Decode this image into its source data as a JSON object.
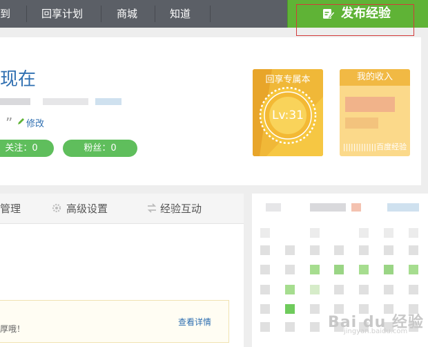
{
  "nav": {
    "items": [
      "到",
      "回享计划",
      "商城",
      "知道"
    ],
    "publish_label": "发布经验"
  },
  "profile": {
    "username_partial": "现在",
    "quote_mark": "”",
    "edit_label": "修改",
    "follow_label": "关注：0",
    "fans_label": "粉丝：0"
  },
  "badge": {
    "title": "回享专属本",
    "level": "Lv:31"
  },
  "income": {
    "title": "我的收入",
    "footer": "|||||||||||||百度经验"
  },
  "tabs": {
    "manage_label": "管理",
    "advanced_label": "高级设置",
    "interact_label": "经验互动"
  },
  "notice": {
    "text": "厚哦！",
    "link": "查看详情"
  },
  "watermark": {
    "brand": "Bai du 经验",
    "sub": "jingyan.baidu.com"
  },
  "colors": {
    "accent_green": "#5fb336",
    "link_blue": "#2f6fb1",
    "highlight_red": "#d33a3a",
    "badge_gold": "#f0b838"
  }
}
